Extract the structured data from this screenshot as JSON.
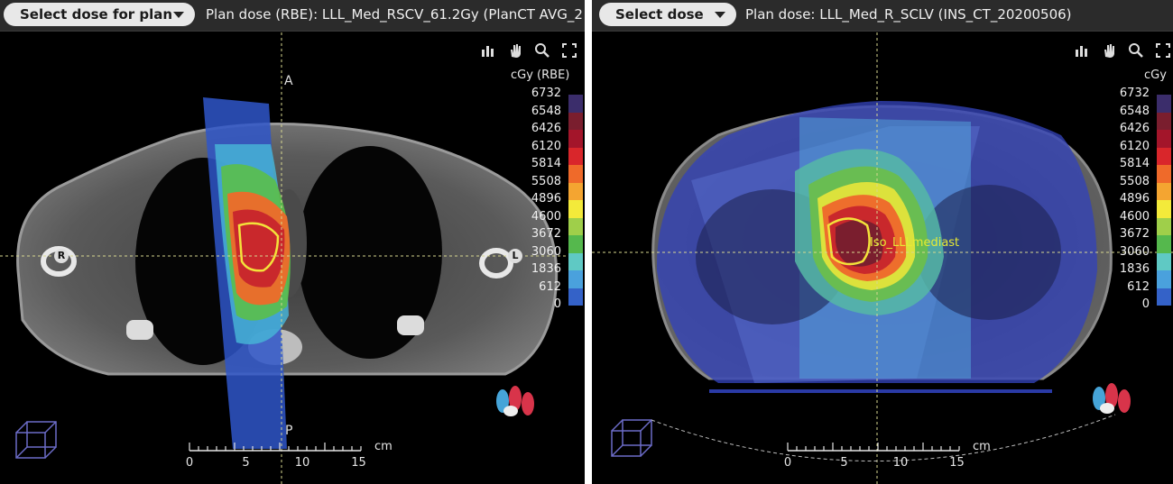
{
  "left": {
    "select_label": "Select dose for plan",
    "plan_dose": "Plan dose (RBE): LLL_Med_RSCV_61.2Gy (PlanCT AVG_2",
    "unit": "cGy (RBE)",
    "legend": [
      "6732",
      "6548",
      "6426",
      "6120",
      "5814",
      "5508",
      "4896",
      "4600",
      "3672",
      "3060",
      "1836",
      "612",
      "0"
    ],
    "orient": {
      "anterior": "A",
      "posterior": "P",
      "right": "R",
      "left": "L"
    },
    "ruler": {
      "ticks": [
        "0",
        "5",
        "10",
        "15"
      ],
      "unit": "cm"
    }
  },
  "right": {
    "select_label": "Select dose",
    "plan_dose": "Plan dose: LLL_Med_R_SCLV (INS_CT_20200506)",
    "unit": "cGy",
    "legend": [
      "6732",
      "6548",
      "6426",
      "6120",
      "5814",
      "5508",
      "4896",
      "4600",
      "3672",
      "3060",
      "1836",
      "612",
      "0"
    ],
    "iso_label": "Iso_LLLmediast",
    "ruler": {
      "ticks": [
        "0",
        "5",
        "10",
        "15"
      ],
      "unit": "cm"
    }
  },
  "toolbar_icons": [
    "layout-icon",
    "pan-hand-icon",
    "zoom-icon",
    "fullscreen-icon"
  ],
  "legend_colors": [
    "#3b2d6b",
    "#7a1e2e",
    "#a3152a",
    "#d9262b",
    "#ef6a2a",
    "#f4a531",
    "#f3ea3a",
    "#9fcf4a",
    "#55b84d",
    "#5fc9c4",
    "#4aa1dd",
    "#3462c8",
    "#2a3aa6"
  ]
}
